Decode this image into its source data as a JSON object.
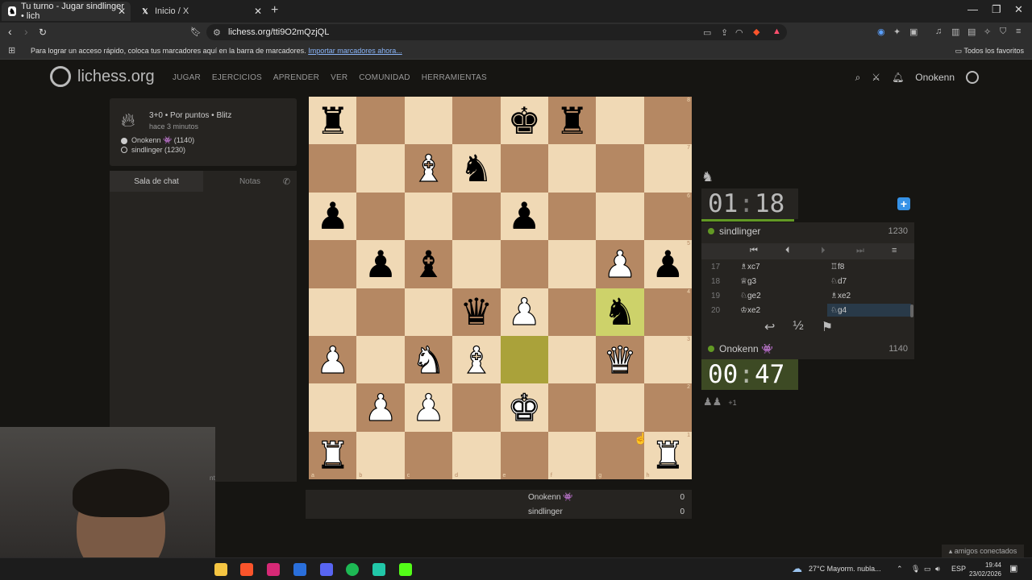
{
  "browser": {
    "tabs": [
      {
        "title": "Tu turno - Jugar sindlinger • lich",
        "active": true
      },
      {
        "title": "Inicio / X",
        "active": false
      }
    ],
    "url": "lichess.org/tti9O2mQzjQL",
    "bookmarks_text": "Para lograr un acceso rápido, coloca tus marcadores aquí en la barra de marcadores.",
    "bookmarks_link": "Importar marcadores ahora...",
    "bookmarks_right": "Todos los favoritos"
  },
  "header": {
    "logo": "lichess.org",
    "nav": [
      "JUGAR",
      "EJERCICIOS",
      "APRENDER",
      "VER",
      "COMUNIDAD",
      "HERRAMIENTAS"
    ],
    "username": "Onokenn"
  },
  "game_info": {
    "type": "3+0 • Por puntos • Blitz",
    "time": "hace 3 minutos",
    "white": "Onokenn 👾 (1140)",
    "black": "sindlinger (1230)"
  },
  "chat": {
    "tab_chat": "Sala de chat",
    "tab_notes": "Notas",
    "partial_text": "nt"
  },
  "board": {
    "files": [
      "a",
      "b",
      "c",
      "d",
      "e",
      "f",
      "g",
      "h"
    ],
    "ranks": [
      "8",
      "7",
      "6",
      "5",
      "4",
      "3",
      "2",
      "1"
    ],
    "position": [
      [
        "br",
        "",
        "",
        "",
        "bk",
        "br",
        "",
        ""
      ],
      [
        "",
        "",
        "wb",
        "bn",
        "",
        "",
        "",
        ""
      ],
      [
        "bp",
        "",
        "",
        "",
        "bp",
        "",
        "",
        ""
      ],
      [
        "",
        "bp",
        "bb",
        "",
        "",
        "",
        "wp",
        "bp"
      ],
      [
        "",
        "",
        "",
        "bq",
        "wp",
        "",
        "bn",
        ""
      ],
      [
        "wp",
        "",
        "wn",
        "wb",
        "",
        "",
        "wq",
        ""
      ],
      [
        "",
        "wp",
        "wp",
        "",
        "wk",
        "",
        "",
        ""
      ],
      [
        "wr",
        "",
        "",
        "",
        "",
        "",
        "",
        "wr"
      ]
    ],
    "last_move": [
      "e3",
      "g4"
    ]
  },
  "score": [
    {
      "name": "Onokenn 👾",
      "value": "0"
    },
    {
      "name": "sindlinger",
      "value": "0"
    }
  ],
  "clocks": {
    "top": {
      "min": "01",
      "sec": "18"
    },
    "bottom": {
      "min": "00",
      "sec": "47"
    }
  },
  "players": {
    "top": {
      "name": "sindlinger",
      "rating": "1230"
    },
    "bottom": {
      "name": "Onokenn 👾",
      "rating": "1140"
    }
  },
  "moves": [
    {
      "num": "17",
      "white": "♗xc7",
      "black": "♖f8"
    },
    {
      "num": "18",
      "white": "♕g3",
      "black": "♘d7"
    },
    {
      "num": "19",
      "white": "♘ge2",
      "black": "♗xe2"
    },
    {
      "num": "20",
      "white": "♔xe2",
      "black": "♘g4"
    }
  ],
  "captured": {
    "pieces": "♟♟",
    "plus": "+1"
  },
  "taskbar": {
    "weather": "27°C  Mayorm. nubla...",
    "lang": "ESP",
    "time": "19:44",
    "date": "23/02/2026"
  },
  "friends": "▴ amigos conectados",
  "colors": {
    "board_light": "#f0d9b5",
    "board_dark": "#b58863",
    "highlight": "#cdd26a",
    "accent_green": "#629924"
  }
}
